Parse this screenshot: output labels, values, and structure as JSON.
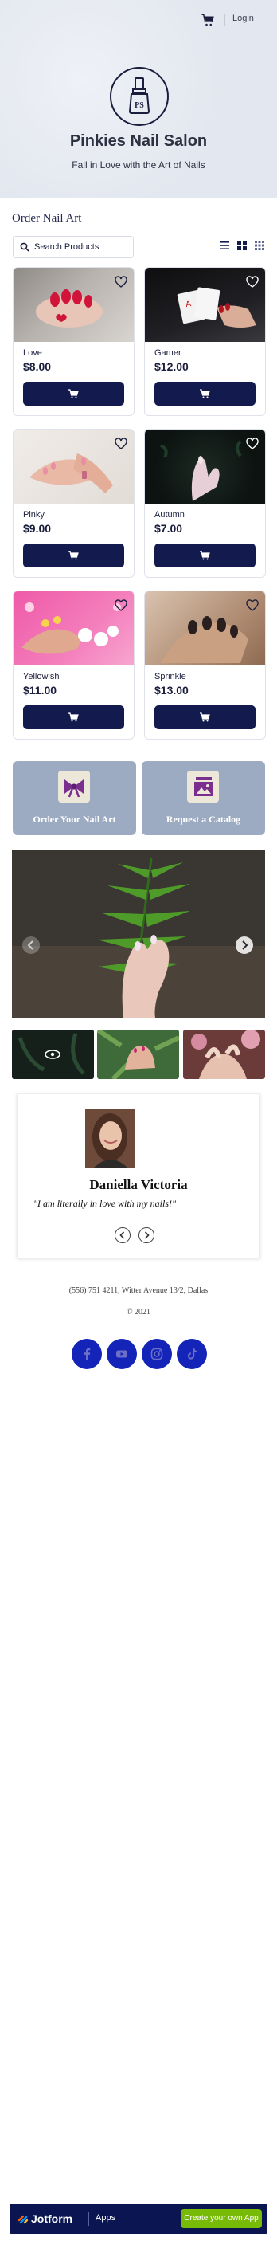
{
  "header": {
    "login_label": "Login",
    "cart_icon": "cart-icon",
    "brand_title": "Pinkies Nail Salon",
    "brand_subtitle": "Fall in Love with the Art of Nails",
    "logo_icon": "nail-polish-icon"
  },
  "catalog": {
    "title": "Order Nail Art",
    "search_placeholder": "Search Products",
    "view_icons": [
      "list-view-icon",
      "grid-view-icon",
      "compact-grid-icon"
    ],
    "products": [
      {
        "name": "Love",
        "price": "$8.00"
      },
      {
        "name": "Gamer",
        "price": "$12.00"
      },
      {
        "name": "Pinky",
        "price": "$9.00"
      },
      {
        "name": "Autumn",
        "price": "$7.00"
      },
      {
        "name": "Yellowish",
        "price": "$11.00"
      },
      {
        "name": "Sprinkle",
        "price": "$13.00"
      }
    ]
  },
  "actions": {
    "order_label": "Order Your Nail Art",
    "catalog_label": "Request a Catalog"
  },
  "testimonial": {
    "name": "Daniella Victoria",
    "quote": "\"I am literally in love with my nails!\""
  },
  "footer_info": {
    "contact": "(556) 751 4211, Witter Avenue 13/2, Dallas",
    "copyright": "© 2021",
    "social": [
      "facebook-icon",
      "youtube-icon",
      "instagram-icon",
      "tiktok-icon"
    ]
  },
  "jotform_bar": {
    "logo": "Jotform",
    "apps": "Apps",
    "cta": "Create your own App"
  },
  "colors": {
    "brand_navy": "#121a4e",
    "action_tile": "#9dabc2",
    "social_blue": "#1424b8",
    "cta_green": "#78bb07"
  }
}
